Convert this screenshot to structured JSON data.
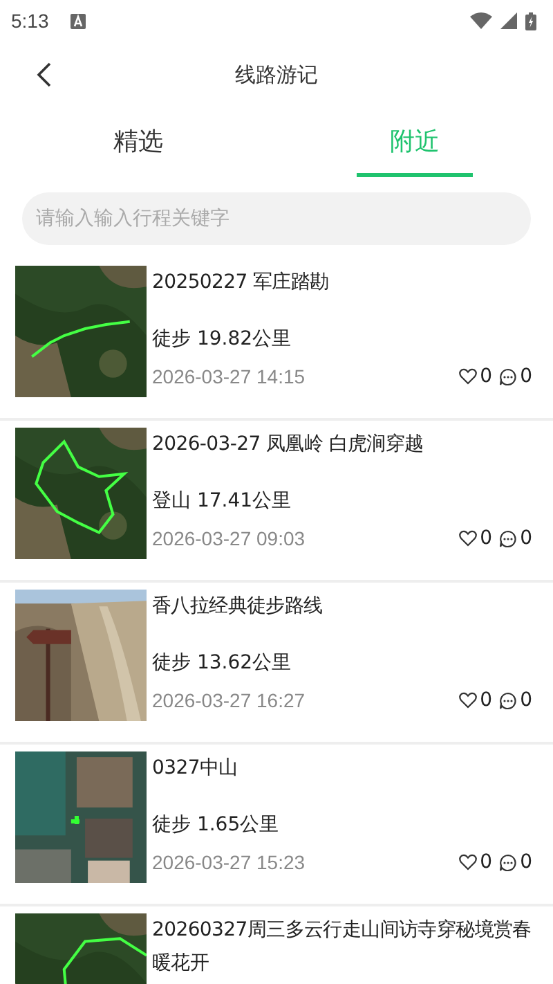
{
  "status_bar": {
    "time": "5:13"
  },
  "header": {
    "title": "线路游记"
  },
  "tabs": [
    {
      "label": "精选",
      "selected": false
    },
    {
      "label": "附近",
      "selected": true
    }
  ],
  "search": {
    "placeholder": "请输入输入行程关键字"
  },
  "trips": [
    {
      "title": "20250227 军庄踏勘",
      "distance": "徒步 19.82公里",
      "time": "2026-03-27 14:15",
      "likes": "0",
      "comments": "0"
    },
    {
      "title": "2026-03-27 凤凰岭 白虎涧穿越",
      "distance": "登山 17.41公里",
      "time": "2026-03-27 09:03",
      "likes": "0",
      "comments": "0"
    },
    {
      "title": "香八拉经典徒步路线",
      "distance": "徒步 13.62公里",
      "time": "2026-03-27 16:27",
      "likes": "0",
      "comments": "0"
    },
    {
      "title": "0327中山",
      "distance": "徒步 1.65公里",
      "time": "2026-03-27 15:23",
      "likes": "0",
      "comments": "0"
    },
    {
      "title": "20260327周三多云行走山间访寺穿秘境赏春暖花开"
    }
  ]
}
